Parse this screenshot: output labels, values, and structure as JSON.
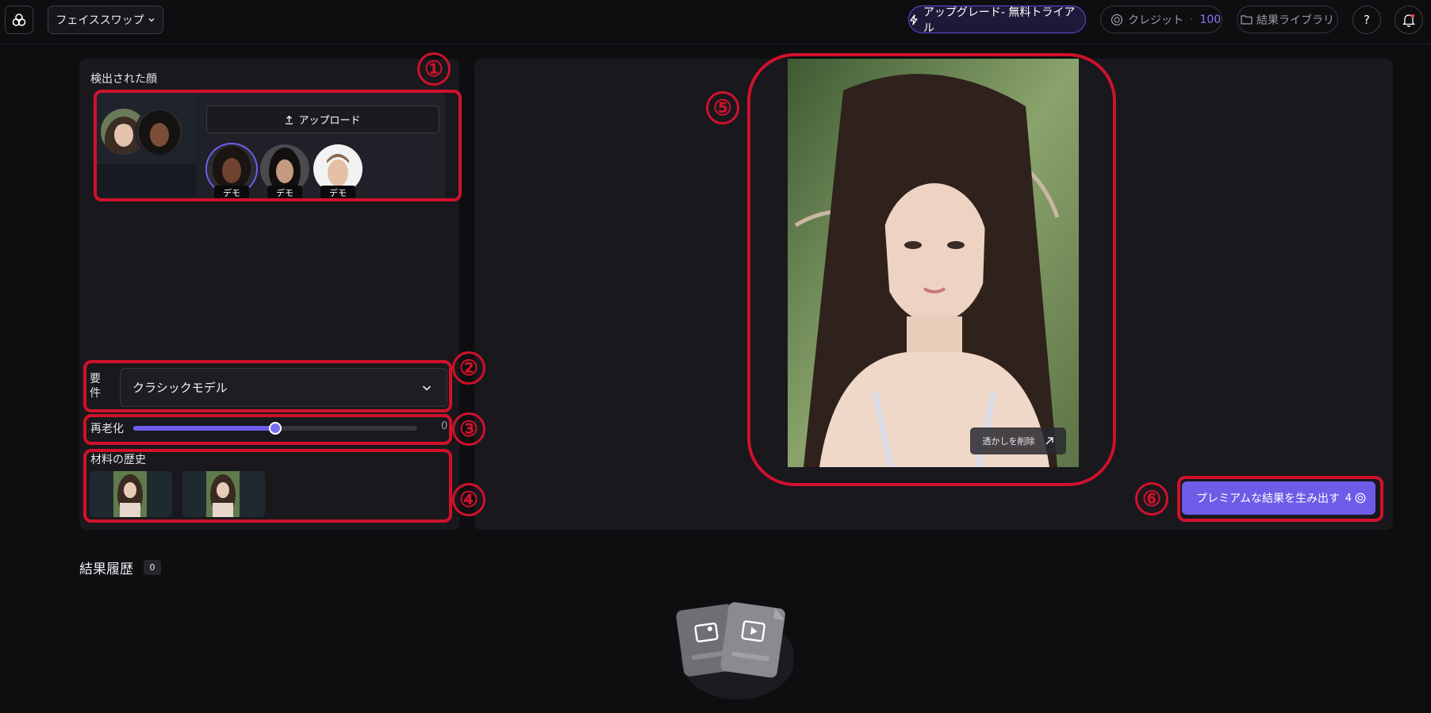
{
  "topbar": {
    "app_name": "フェイススワップ",
    "upgrade_label": "アップグレード- 無料トライアル",
    "credit_label": "クレジット",
    "credit_separator": "·",
    "credit_value": "100",
    "library_label": "結果ライブラリ",
    "help_label": "?"
  },
  "left_panel": {
    "detected_faces_title": "検出された顔",
    "upload_label": "アップロード",
    "demo_faces": [
      {
        "tag": "デモ",
        "selected": true
      },
      {
        "tag": "デモ",
        "selected": false
      },
      {
        "tag": "デモ",
        "selected": false
      }
    ],
    "requirement_label": "要件",
    "model_select_value": "クラシックモデル",
    "reaging_label": "再老化",
    "reaging_value": "0",
    "reaging_level_fraction": 0.5,
    "material_history_title": "材料の歴史"
  },
  "preview": {
    "remove_watermark_label": "透かしを削除"
  },
  "generate": {
    "label": "プレミアムな結果を生み出す",
    "cost": "4"
  },
  "annotations": [
    "①",
    "②",
    "③",
    "④",
    "⑤",
    "⑥"
  ],
  "results_history": {
    "title": "結果履歴",
    "count": "0"
  },
  "colors": {
    "accent": "#6c5ce7",
    "annotation_red": "#d0112b",
    "background": "#0e0e11",
    "panel": "#18181d"
  }
}
